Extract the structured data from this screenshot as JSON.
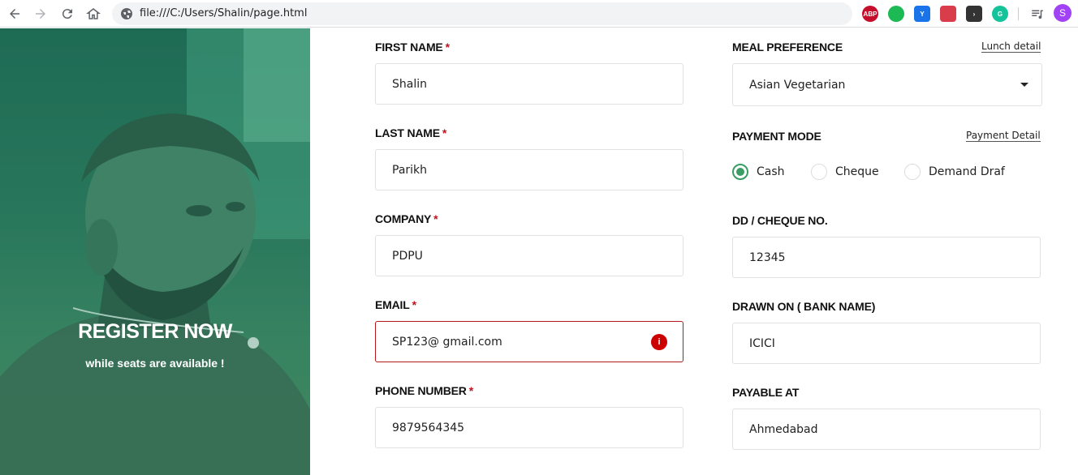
{
  "browser": {
    "url": "file:///C:/Users/Shalin/page.html",
    "extensions": [
      {
        "name": "adblock-plus-icon",
        "text": "ABP",
        "color": "#c70d2c"
      },
      {
        "name": "green-circle-extension-icon",
        "text": "",
        "color": "#1db954"
      },
      {
        "name": "y-extension-icon",
        "text": "Y",
        "color": "#1a73e8"
      },
      {
        "name": "pocket-extension-icon",
        "text": "",
        "color": "#d93c4b"
      },
      {
        "name": "dark-arrow-extension-icon",
        "text": "›",
        "color": "#333333"
      },
      {
        "name": "grammarly-icon",
        "text": "G",
        "color": "#15c39a"
      }
    ],
    "avatar_letter": "S"
  },
  "hero": {
    "title": "REGISTER NOW",
    "subtitle": "while seats are available !"
  },
  "form": {
    "first_name": {
      "label": "FIRST NAME",
      "required": "*",
      "value": "Shalin"
    },
    "last_name": {
      "label": "LAST NAME",
      "required": "*",
      "value": "Parikh"
    },
    "company": {
      "label": "COMPANY",
      "required": "*",
      "value": "PDPU"
    },
    "email": {
      "label": "EMAIL",
      "required": "*",
      "value": "SP123@ gmail.com",
      "error_icon": "i"
    },
    "phone": {
      "label": "PHONE NUMBER",
      "required": "*",
      "value": "9879564345"
    },
    "meal": {
      "label": "MEAL PREFERENCE",
      "link": "Lunch detail",
      "selected": "Asian Vegetarian"
    },
    "payment": {
      "label": "PAYMENT MODE",
      "link": "Payment Detail",
      "options": [
        "Cash",
        "Cheque",
        "Demand Draf"
      ],
      "selected": "Cash"
    },
    "dd_cheque": {
      "label": "DD / CHEQUE NO.",
      "value": "12345"
    },
    "drawn_on": {
      "label": "DRAWN ON ( BANK NAME)",
      "value": "ICICI"
    },
    "payable_at": {
      "label": "PAYABLE AT",
      "value": "Ahmedabad"
    }
  }
}
